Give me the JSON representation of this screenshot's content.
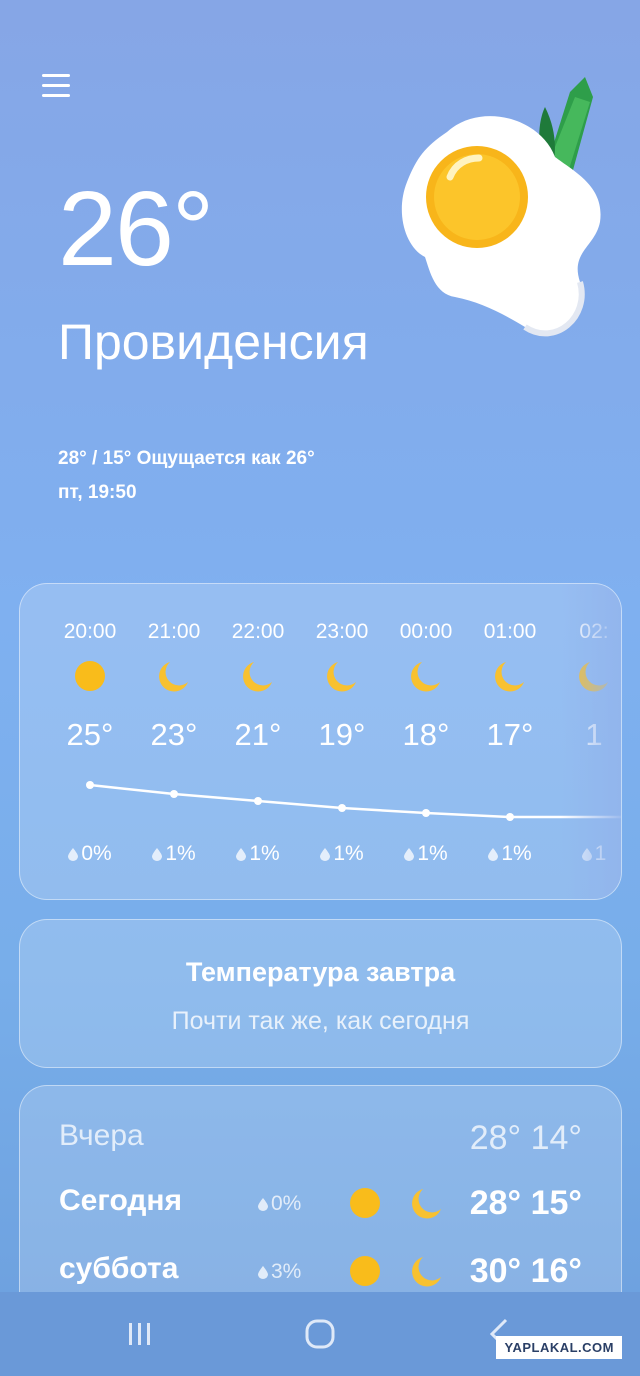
{
  "current": {
    "temperature": "26°",
    "city": "Провиденсия",
    "minmax_feels": "28° / 15° Ощущается как 26°",
    "datetime": "пт, 19:50"
  },
  "hourly": [
    {
      "time": "20:00",
      "icon": "sun-icon",
      "temp": "25°",
      "precip": "0%"
    },
    {
      "time": "21:00",
      "icon": "moon-icon",
      "temp": "23°",
      "precip": "1%"
    },
    {
      "time": "22:00",
      "icon": "moon-icon",
      "temp": "21°",
      "precip": "1%"
    },
    {
      "time": "23:00",
      "icon": "moon-icon",
      "temp": "19°",
      "precip": "1%"
    },
    {
      "time": "00:00",
      "icon": "moon-icon",
      "temp": "18°",
      "precip": "1%"
    },
    {
      "time": "01:00",
      "icon": "moon-icon",
      "temp": "17°",
      "precip": "1%"
    },
    {
      "time": "02:",
      "icon": "moon-icon",
      "temp": "1",
      "precip": "1"
    }
  ],
  "tomorrow": {
    "title": "Температура завтра",
    "subtitle": "Почти так же, как сегодня"
  },
  "daily": [
    {
      "name": "Вчера",
      "precip": "",
      "temps": "28° 14°",
      "dim": true
    },
    {
      "name": "Сегодня",
      "precip": "0%",
      "temps": "28° 15°",
      "dim": false
    },
    {
      "name": "суббота",
      "precip": "3%",
      "temps": "30° 16°",
      "dim": false
    }
  ],
  "watermark": "YAPLAKAL.COM",
  "colors": {
    "sun": "#f9bc1b",
    "moon": "#f8c130",
    "card_border": "rgba(255,255,255,0.45)"
  }
}
